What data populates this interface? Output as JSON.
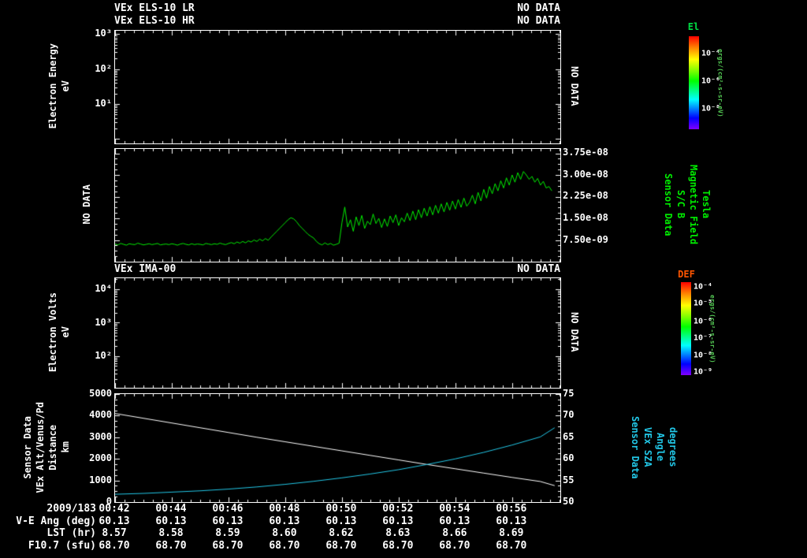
{
  "colors": {
    "accent_green": "#00ee00",
    "accent_cyan": "#22c8e8",
    "el_label": "#00dd44",
    "def_label": "#ff5500",
    "units_green": "#55cc55"
  },
  "header": {
    "els_lr_title": "VEx ELS-10 LR",
    "els_lr_status": "NO DATA",
    "els_hr_title": "VEx ELS-10 HR",
    "els_hr_status": "NO DATA"
  },
  "panels": {
    "els": {
      "ylabel": [
        "Electron Energy",
        "eV"
      ],
      "yticks": [
        {
          "label": "10³",
          "pos": 0.03
        },
        {
          "label": "10²",
          "pos": 0.34
        },
        {
          "label": "10¹",
          "pos": 0.65
        }
      ],
      "right_label": "NO DATA"
    },
    "mag": {
      "left_label": "NO DATA",
      "yticks": [
        {
          "label": "3.75e-08",
          "pos": 0.038
        },
        {
          "label": "3.00e-08",
          "pos": 0.231
        },
        {
          "label": "2.25e-08",
          "pos": 0.423
        },
        {
          "label": "1.50e-08",
          "pos": 0.615
        },
        {
          "label": "7.50e-09",
          "pos": 0.808
        }
      ],
      "right_labels": [
        "Sensor Data",
        "S/C B",
        "Magnetic Field",
        "Tesla"
      ]
    },
    "ima": {
      "title": "VEx IMA-00",
      "status": "NO DATA",
      "ylabel": [
        "Electron Volts",
        "eV"
      ],
      "yticks": [
        {
          "label": "10⁴",
          "pos": 0.1
        },
        {
          "label": "10³",
          "pos": 0.41
        },
        {
          "label": "10²",
          "pos": 0.71
        }
      ],
      "right_label": "NO DATA"
    },
    "bottom": {
      "left_labels": [
        "Sensor Data",
        "VEx Alt/Venus/Pd",
        "Distance",
        "km"
      ],
      "right_labels": [
        "Sensor Data",
        "VEx SZA",
        "Angle",
        "degrees"
      ],
      "left_yticks": [
        {
          "label": "5000",
          "pos": 0.0
        },
        {
          "label": "4000",
          "pos": 0.2
        },
        {
          "label": "3000",
          "pos": 0.4
        },
        {
          "label": "2000",
          "pos": 0.6
        },
        {
          "label": "1000",
          "pos": 0.8
        },
        {
          "label": "0",
          "pos": 1.0
        }
      ],
      "right_yticks": [
        {
          "label": "75",
          "pos": 0.0
        },
        {
          "label": "70",
          "pos": 0.2
        },
        {
          "label": "65",
          "pos": 0.4
        },
        {
          "label": "60",
          "pos": 0.6
        },
        {
          "label": "55",
          "pos": 0.8
        },
        {
          "label": "50",
          "pos": 1.0
        }
      ]
    }
  },
  "colorbars": {
    "el": {
      "title": "El",
      "ticks": [
        {
          "label": "10⁻⁴",
          "pos": 0.19
        },
        {
          "label": "10⁻⁶",
          "pos": 0.48
        },
        {
          "label": "10⁻⁸",
          "pos": 0.78
        }
      ],
      "units": "ergs/(cm²-s-sr-eV)"
    },
    "def": {
      "title": "DEF",
      "ticks": [
        {
          "label": "10⁻⁴",
          "pos": 0.05
        },
        {
          "label": "10⁻⁵",
          "pos": 0.23
        },
        {
          "label": "10⁻⁶",
          "pos": 0.42
        },
        {
          "label": "10⁻⁷",
          "pos": 0.6
        },
        {
          "label": "10⁻⁸",
          "pos": 0.79
        },
        {
          "label": "10⁻⁹",
          "pos": 0.97
        }
      ],
      "units": "ergs/(cm²-s-sr-eV)"
    }
  },
  "timeaxis": {
    "date": "2009/183",
    "labels": [
      "00:42",
      "00:44",
      "00:46",
      "00:48",
      "00:50",
      "00:52",
      "00:54",
      "00:56"
    ],
    "tick_minutes": [
      42,
      44,
      46,
      48,
      50,
      52,
      54,
      56
    ],
    "range": [
      42,
      57.7
    ]
  },
  "table": {
    "rows": [
      {
        "label": "V-E Ang (deg)",
        "values": [
          "60.13",
          "60.13",
          "60.13",
          "60.13",
          "60.13",
          "60.13",
          "60.13",
          "60.13"
        ]
      },
      {
        "label": "LST (hr)",
        "values": [
          "8.57",
          "8.58",
          "8.59",
          "8.60",
          "8.62",
          "8.63",
          "8.66",
          "8.69"
        ]
      },
      {
        "label": "F10.7 (sfu)",
        "values": [
          "68.70",
          "68.70",
          "68.70",
          "68.70",
          "68.70",
          "68.70",
          "68.70",
          "68.70"
        ]
      }
    ]
  },
  "chart_data": [
    {
      "type": "line",
      "name": "sc_b_magnetic_field",
      "ylabel": "S/C B Magnetic Field (Tesla)",
      "color": "#00ee00",
      "xlim_minutes": [
        42,
        57.7
      ],
      "ylim": [
        0,
        3.9e-08
      ],
      "x_start_minute": 42,
      "dt_minute": 0.1,
      "unit_scale": 1e-09,
      "values_1e9": [
        6.1,
        5.8,
        6.3,
        6.0,
        5.7,
        6.2,
        6.0,
        5.9,
        6.4,
        6.1,
        5.8,
        6.0,
        6.2,
        5.9,
        6.1,
        6.3,
        5.8,
        6.0,
        6.1,
        5.9,
        6.2,
        6.0,
        5.7,
        6.1,
        6.3,
        6.0,
        5.8,
        6.2,
        5.9,
        6.1,
        6.0,
        5.8,
        6.3,
        6.1,
        5.9,
        6.2,
        6.0,
        6.4,
        6.1,
        5.9,
        6.3,
        6.6,
        6.2,
        6.8,
        6.4,
        7.0,
        6.5,
        7.2,
        6.8,
        7.5,
        7.0,
        7.8,
        7.2,
        8.0,
        7.4,
        8.5,
        9.5,
        10.5,
        11.5,
        12.5,
        13.5,
        14.5,
        15.2,
        14.8,
        13.8,
        12.5,
        11.5,
        10.5,
        9.5,
        8.8,
        8.2,
        7.0,
        6.2,
        5.8,
        6.5,
        5.9,
        6.3,
        5.7,
        6.0,
        6.4,
        13.5,
        18.9,
        12.0,
        14.5,
        10.5,
        15.5,
        12.5,
        16.0,
        11.5,
        14.0,
        12.8,
        16.5,
        13.2,
        15.0,
        11.8,
        14.8,
        12.2,
        15.8,
        13.5,
        16.2,
        12.5,
        15.2,
        13.8,
        16.8,
        14.2,
        17.5,
        14.5,
        18.0,
        15.2,
        18.5,
        15.8,
        19.0,
        16.2,
        19.5,
        16.8,
        20.0,
        17.2,
        20.5,
        17.8,
        21.0,
        18.2,
        21.5,
        18.8,
        22.0,
        19.2,
        20.5,
        23.0,
        20.0,
        24.0,
        21.0,
        25.0,
        22.0,
        26.0,
        23.5,
        27.0,
        24.5,
        28.0,
        25.5,
        29.0,
        26.5,
        30.0,
        27.5,
        30.8,
        28.5,
        31.2,
        30.0,
        28.5,
        29.5,
        27.5,
        28.8,
        26.5,
        27.8,
        25.5,
        26.0,
        24.5
      ]
    },
    {
      "type": "line",
      "name": "vex_altitude_km",
      "ylabel": "VEx Alt/Venus/Pd Distance (km)",
      "color": "#ffffff",
      "xlim_minutes": [
        42,
        57.7
      ],
      "ylim": [
        0,
        5000
      ],
      "x_minutes": [
        42,
        43,
        44,
        45,
        46,
        47,
        48,
        49,
        50,
        51,
        52,
        53,
        54,
        55,
        56,
        57,
        57.5
      ],
      "values": [
        4100,
        3880,
        3660,
        3440,
        3220,
        3000,
        2790,
        2580,
        2370,
        2160,
        1950,
        1740,
        1540,
        1340,
        1140,
        950,
        760
      ]
    },
    {
      "type": "line",
      "name": "vex_sza_deg",
      "ylabel": "VEx SZA Angle (degrees)",
      "color": "#22c8e8",
      "xlim_minutes": [
        42,
        57.7
      ],
      "ylim": [
        50,
        75
      ],
      "x_minutes": [
        42,
        43,
        44,
        45,
        46,
        47,
        48,
        49,
        50,
        51,
        52,
        53,
        54,
        55,
        56,
        57,
        57.5
      ],
      "values": [
        51.8,
        52.0,
        52.3,
        52.6,
        53.0,
        53.5,
        54.1,
        54.8,
        55.6,
        56.5,
        57.5,
        58.7,
        60.0,
        61.5,
        63.2,
        65.1,
        67.2
      ]
    },
    {
      "type": "none",
      "name": "els_spectrogram",
      "status": "NO DATA"
    },
    {
      "type": "none",
      "name": "ima_spectrogram",
      "status": "NO DATA"
    }
  ]
}
